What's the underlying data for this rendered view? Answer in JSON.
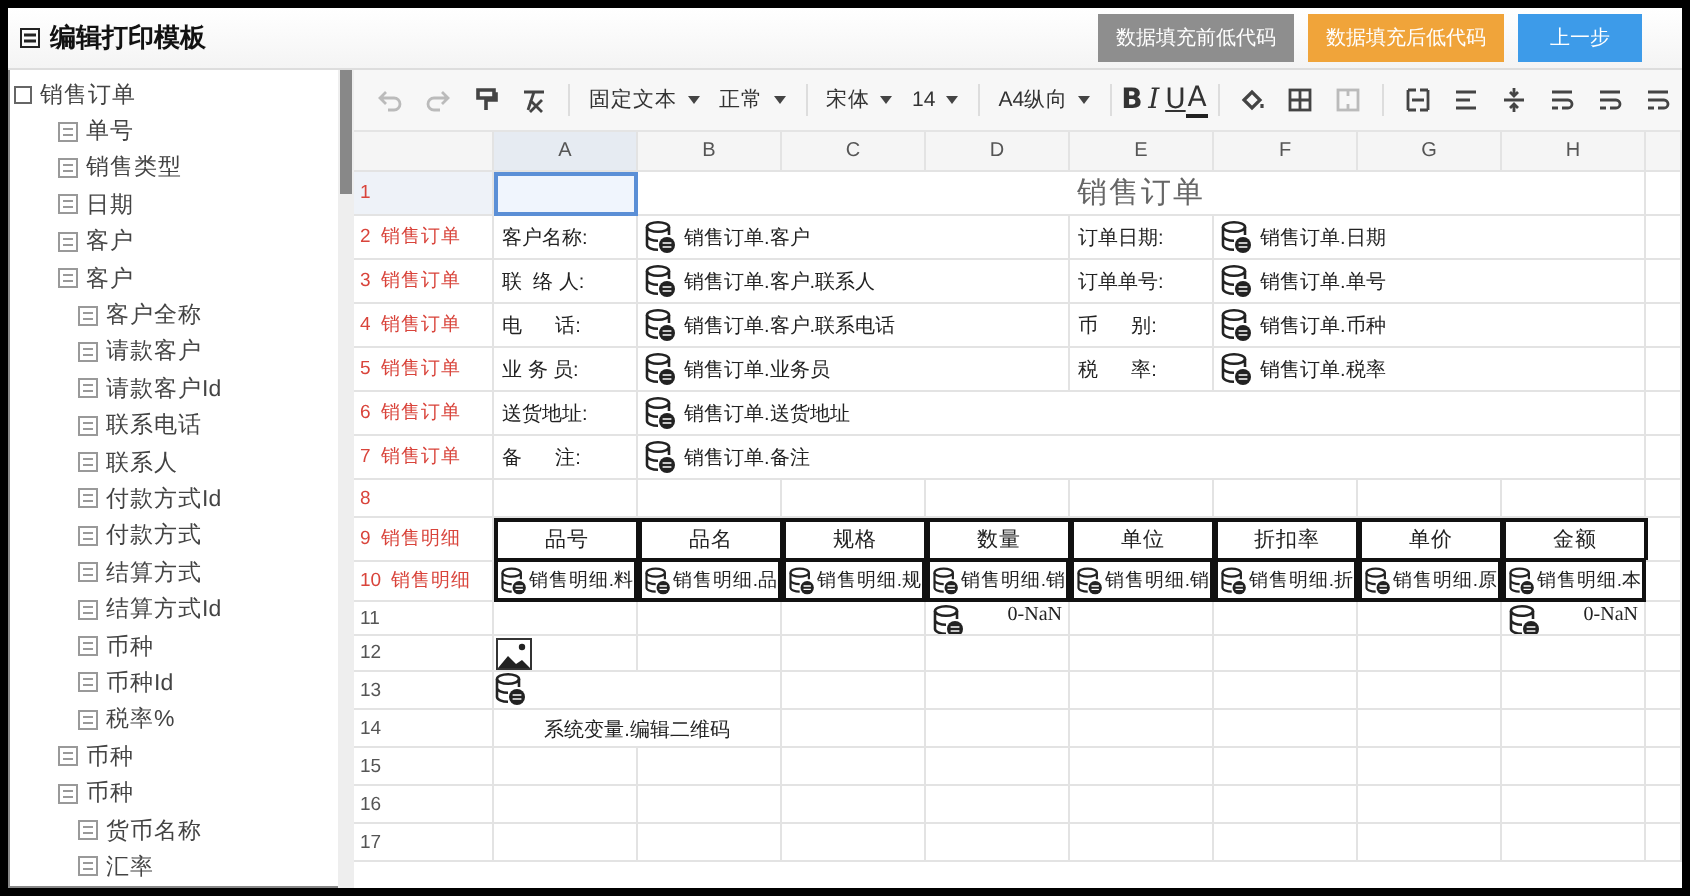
{
  "window": {
    "title": "编辑打印模板"
  },
  "header_buttons": [
    {
      "label": "数据填充前低代码",
      "kind": "secondary"
    },
    {
      "label": "数据填充后低代码",
      "kind": "warning"
    },
    {
      "label": "上一步",
      "kind": "primary"
    }
  ],
  "tree": [
    {
      "label": "销售订单",
      "children": [
        {
          "label": "单号"
        },
        {
          "label": "销售类型"
        },
        {
          "label": "日期"
        },
        {
          "label": "客户"
        },
        {
          "label": "客户",
          "children": [
            {
              "label": "客户全称"
            },
            {
              "label": "请款客户"
            },
            {
              "label": "请款客户Id"
            },
            {
              "label": "联系电话"
            },
            {
              "label": "联系人"
            },
            {
              "label": "付款方式Id"
            },
            {
              "label": "付款方式"
            },
            {
              "label": "结算方式"
            },
            {
              "label": "结算方式Id"
            },
            {
              "label": "币种"
            },
            {
              "label": "币种Id"
            },
            {
              "label": "税率%"
            }
          ]
        },
        {
          "label": "币种"
        },
        {
          "label": "币种",
          "children": [
            {
              "label": "货币名称"
            },
            {
              "label": "汇率"
            }
          ]
        }
      ]
    }
  ],
  "toolbar": {
    "dropdowns": [
      "固定文本",
      "正常",
      "宋体",
      "14",
      "A4纵向"
    ],
    "format_buttons": [
      {
        "label": "B",
        "kind": "bold"
      },
      {
        "label": "I",
        "kind": "italic"
      },
      {
        "label": "U",
        "kind": "underline"
      },
      {
        "label": "A",
        "kind": "color"
      }
    ]
  },
  "sheet": {
    "columns": [
      {
        "label": "A",
        "selected": true
      },
      {
        "label": "B",
        "selected": false
      },
      {
        "label": "C",
        "selected": false
      },
      {
        "label": "D",
        "selected": false
      },
      {
        "label": "E",
        "selected": false
      },
      {
        "label": "F",
        "selected": false
      },
      {
        "label": "G",
        "selected": false
      },
      {
        "label": "H",
        "selected": false
      }
    ],
    "rows": [
      {
        "number": "1",
        "marked": true,
        "selected": true,
        "cells": [
          "",
          {
            "merged_right": true
          },
          {
            "merged_right": true
          },
          {
            "merged_right": true
          },
          {
            "kind": "title",
            "text": "销售订单"
          },
          {
            "merged_left": true
          },
          {
            "merged_left": true
          },
          {
            "merged_left": true
          }
        ]
      },
      {
        "number": "2",
        "label": "销售订单",
        "marked": true,
        "selected": false,
        "cells": [
          {
            "kind": "label",
            "text": "客户名称:"
          },
          {
            "kind": "field",
            "text": "销售订单.客户"
          },
          {
            "merged_left": true
          },
          {
            "merged_left": true
          },
          {
            "kind": "label",
            "text": "订单日期:"
          },
          {
            "kind": "field",
            "text": "销售订单.日期"
          },
          {
            "merged_left": true
          },
          {
            "merged_left": true
          }
        ]
      },
      {
        "number": "3",
        "label": "销售订单",
        "marked": true,
        "selected": false,
        "cells": [
          {
            "kind": "label",
            "text": "联  络 人:"
          },
          {
            "kind": "field",
            "text": "销售订单.客户.联系人"
          },
          {
            "merged_left": true
          },
          {
            "merged_left": true
          },
          {
            "kind": "label",
            "text": "订单单号:"
          },
          {
            "kind": "field",
            "text": "销售订单.单号"
          },
          {
            "merged_left": true
          },
          {
            "merged_left": true
          }
        ]
      },
      {
        "number": "4",
        "label": "销售订单",
        "marked": true,
        "selected": false,
        "cells": [
          {
            "kind": "label",
            "text": "电      话:"
          },
          {
            "kind": "field",
            "text": "销售订单.客户.联系电话"
          },
          {
            "merged_left": true
          },
          {
            "merged_left": true
          },
          {
            "kind": "label",
            "text": "币      别:"
          },
          {
            "kind": "field",
            "text": "销售订单.币种"
          },
          {
            "merged_left": true
          },
          {
            "merged_left": true
          }
        ]
      },
      {
        "number": "5",
        "label": "销售订单",
        "marked": true,
        "selected": false,
        "cells": [
          {
            "kind": "label",
            "text": "业 务 员:"
          },
          {
            "kind": "field",
            "text": "销售订单.业务员"
          },
          {
            "merged_left": true
          },
          {
            "merged_left": true
          },
          {
            "kind": "label",
            "text": "税      率:"
          },
          {
            "kind": "field",
            "text": "销售订单.税率"
          },
          {
            "merged_left": true
          },
          {
            "merged_left": true
          }
        ]
      },
      {
        "number": "6",
        "label": "销售订单",
        "marked": true,
        "selected": false,
        "cells": [
          {
            "kind": "label",
            "text": "送货地址:"
          },
          {
            "kind": "field",
            "text": "销售订单.送货地址"
          },
          {
            "merged_left": true
          },
          {
            "merged_left": true
          },
          {
            "merged_left": true
          },
          {
            "merged_left": true
          },
          {
            "merged_left": true
          },
          {
            "merged_left": true
          }
        ]
      },
      {
        "number": "7",
        "label": "销售订单",
        "marked": true,
        "selected": false,
        "cells": [
          {
            "kind": "label",
            "text": "备      注:"
          },
          {
            "kind": "field",
            "text": "销售订单.备注"
          },
          {
            "merged_left": true
          },
          {
            "merged_left": true
          },
          {
            "merged_left": true
          },
          {
            "merged_left": true
          },
          {
            "merged_left": true
          },
          {
            "merged_left": true
          }
        ]
      },
      {
        "number": "8",
        "marked": true,
        "selected": false,
        "cells": [
          "",
          "",
          "",
          "",
          "",
          "",
          "",
          ""
        ]
      },
      {
        "number": "9",
        "label": "销售明细",
        "marked": true,
        "selected": false,
        "cells": [
          {
            "kind": "header",
            "text": "品号"
          },
          {
            "kind": "header",
            "text": "品名"
          },
          {
            "kind": "header",
            "text": "规格"
          },
          {
            "kind": "header",
            "text": "数量"
          },
          {
            "kind": "header",
            "text": "单位"
          },
          {
            "kind": "header",
            "text": "折扣率"
          },
          {
            "kind": "header",
            "text": "单价"
          },
          {
            "kind": "header",
            "text": "金额"
          }
        ]
      },
      {
        "number": "10",
        "label": "销售明细",
        "marked": true,
        "selected": false,
        "cells": [
          {
            "kind": "detail",
            "text": "销售明细.料"
          },
          {
            "kind": "detail",
            "text": "销售明细.品"
          },
          {
            "kind": "detail",
            "text": "销售明细.规"
          },
          {
            "kind": "detail",
            "text": "销售明细.销"
          },
          {
            "kind": "detail",
            "text": "销售明细.销"
          },
          {
            "kind": "detail",
            "text": "销售明细.折"
          },
          {
            "kind": "detail",
            "text": "销售明细.原"
          },
          {
            "kind": "detail",
            "text": "销售明细.本"
          }
        ]
      },
      {
        "number": "11",
        "marked": false,
        "selected": false,
        "cells": [
          "",
          "",
          "",
          {
            "kind": "sum",
            "text": "0-NaN"
          },
          "",
          "",
          "",
          {
            "kind": "sum",
            "text": "0-NaN"
          }
        ]
      },
      {
        "number": "12",
        "marked": false,
        "selected": false,
        "cells": [
          {
            "kind": "image"
          },
          "",
          "",
          "",
          "",
          "",
          "",
          ""
        ]
      },
      {
        "number": "13",
        "marked": false,
        "selected": false,
        "cells": [
          {
            "kind": "qr"
          },
          {
            "merged_left": true
          },
          "",
          "",
          "",
          "",
          "",
          ""
        ]
      },
      {
        "number": "14",
        "marked": false,
        "selected": false,
        "cells": [
          {
            "kind": "caption",
            "text": "系统变量.编辑二维码"
          },
          {
            "merged_left": true
          },
          "",
          "",
          "",
          "",
          "",
          ""
        ]
      },
      {
        "number": "15",
        "marked": false,
        "selected": false,
        "cells": [
          "",
          "",
          "",
          "",
          "",
          "",
          "",
          ""
        ]
      },
      {
        "number": "16",
        "marked": false,
        "selected": false,
        "cells": [
          "",
          "",
          "",
          "",
          "",
          "",
          "",
          ""
        ]
      },
      {
        "number": "17",
        "marked": false,
        "selected": false,
        "cells": [
          "",
          "",
          "",
          "",
          "",
          "",
          "",
          ""
        ]
      }
    ]
  }
}
